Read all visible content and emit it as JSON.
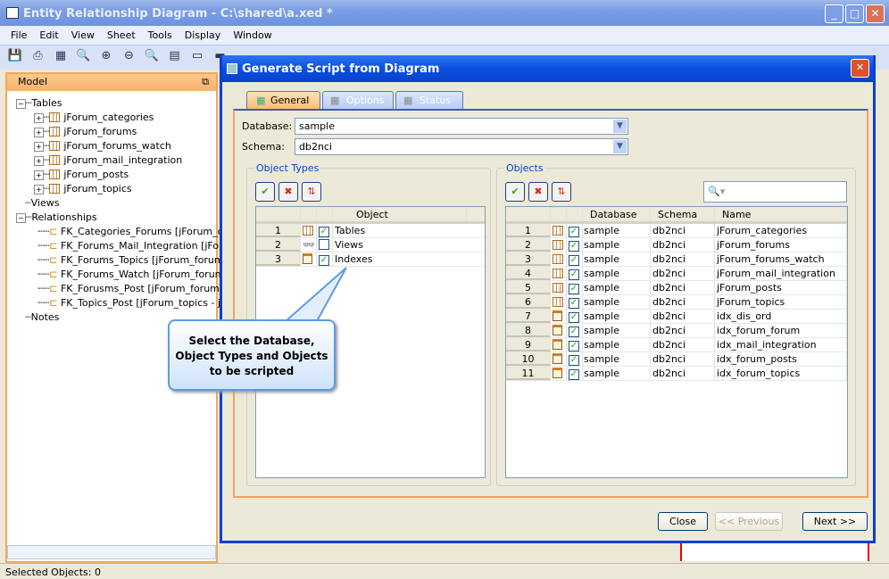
{
  "window": {
    "title": "Entity Relationship Diagram - C:\\shared\\a.xed *"
  },
  "menu": [
    "File",
    "Edit",
    "View",
    "Sheet",
    "Tools",
    "Display",
    "Window"
  ],
  "model": {
    "title": "Model",
    "tables_label": "Tables",
    "tables": [
      "jForum_categories",
      "jForum_forums",
      "jForum_forums_watch",
      "jForum_mail_integration",
      "jForum_posts",
      "jForum_topics"
    ],
    "views_label": "Views",
    "relationships_label": "Relationships",
    "relationships": [
      "FK_Categories_Forums [jForum_ca",
      "FK_Forums_Mail_Integration [jForu",
      "FK_Forums_Topics [jForum_forums",
      "FK_Forums_Watch [jForum_forums",
      "FK_Forusms_Post [jForum_forums",
      "FK_Topics_Post [jForum_topics - jF"
    ],
    "notes_label": "Notes"
  },
  "status": "Selected Objects: 0",
  "dialog": {
    "title": "Generate Script from Diagram",
    "tabs": [
      "General",
      "Options",
      "Status"
    ],
    "database_label": "Database:",
    "database_value": "sample",
    "schema_label": "Schema:",
    "schema_value": "db2nci",
    "object_types": {
      "title": "Object Types",
      "column": "Object",
      "rows": [
        {
          "n": "1",
          "icon": "table-icon",
          "checked": true,
          "label": "Tables"
        },
        {
          "n": "2",
          "icon": "view-icon",
          "checked": false,
          "label": "Views"
        },
        {
          "n": "3",
          "icon": "index-icon",
          "checked": true,
          "label": "Indexes"
        }
      ]
    },
    "objects": {
      "title": "Objects",
      "search_placeholder": "",
      "columns": [
        "Database",
        "Schema",
        "Name"
      ],
      "rows": [
        {
          "n": "1",
          "icon": "table",
          "db": "sample",
          "schema": "db2nci",
          "name": "jForum_categories"
        },
        {
          "n": "2",
          "icon": "table",
          "db": "sample",
          "schema": "db2nci",
          "name": "jForum_forums"
        },
        {
          "n": "3",
          "icon": "table",
          "db": "sample",
          "schema": "db2nci",
          "name": "jForum_forums_watch"
        },
        {
          "n": "4",
          "icon": "table",
          "db": "sample",
          "schema": "db2nci",
          "name": "jForum_mail_integration"
        },
        {
          "n": "5",
          "icon": "table",
          "db": "sample",
          "schema": "db2nci",
          "name": "jForum_posts"
        },
        {
          "n": "6",
          "icon": "table",
          "db": "sample",
          "schema": "db2nci",
          "name": "jForum_topics"
        },
        {
          "n": "7",
          "icon": "index",
          "db": "sample",
          "schema": "db2nci",
          "name": "idx_dis_ord"
        },
        {
          "n": "8",
          "icon": "index",
          "db": "sample",
          "schema": "db2nci",
          "name": "idx_forum_forum"
        },
        {
          "n": "9",
          "icon": "index",
          "db": "sample",
          "schema": "db2nci",
          "name": "idx_mail_integration"
        },
        {
          "n": "10",
          "icon": "index",
          "db": "sample",
          "schema": "db2nci",
          "name": "idx_forum_posts"
        },
        {
          "n": "11",
          "icon": "index",
          "db": "sample",
          "schema": "db2nci",
          "name": "idx_forum_topics"
        }
      ]
    },
    "buttons": {
      "close": "Close",
      "previous": "<< Previous",
      "next": "Next >>"
    }
  },
  "callout": "Select the Database, Object Types and Objects to be scripted"
}
